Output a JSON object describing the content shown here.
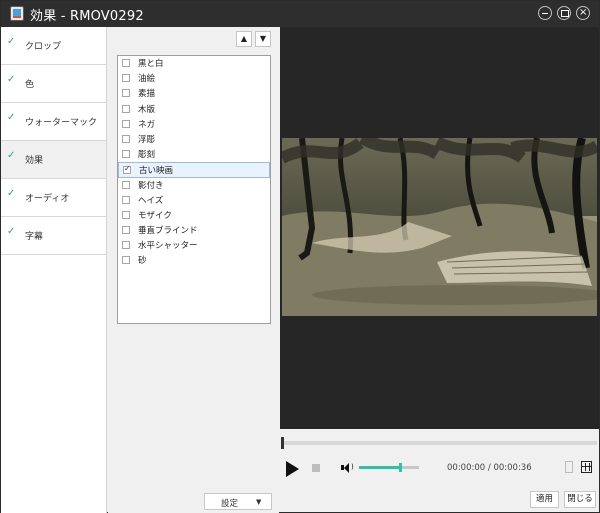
{
  "window": {
    "title": "効果 - RMOV0292"
  },
  "sidebar": {
    "items": [
      {
        "label": "クロップ",
        "checked": true,
        "active": false
      },
      {
        "label": "色",
        "checked": true,
        "active": false
      },
      {
        "label": "ウォーターマック",
        "checked": true,
        "active": false
      },
      {
        "label": "効果",
        "checked": true,
        "active": true
      },
      {
        "label": "オーディオ",
        "checked": true,
        "active": false
      },
      {
        "label": "字幕",
        "checked": true,
        "active": false
      }
    ]
  },
  "effects": {
    "items": [
      {
        "label": "黒と白",
        "checked": false,
        "selected": false
      },
      {
        "label": "油絵",
        "checked": false,
        "selected": false
      },
      {
        "label": "素描",
        "checked": false,
        "selected": false
      },
      {
        "label": "木版",
        "checked": false,
        "selected": false
      },
      {
        "label": "ネガ",
        "checked": false,
        "selected": false
      },
      {
        "label": "浮彫",
        "checked": false,
        "selected": false
      },
      {
        "label": "彫刻",
        "checked": false,
        "selected": false
      },
      {
        "label": "古い映画",
        "checked": true,
        "selected": true
      },
      {
        "label": "影付き",
        "checked": false,
        "selected": false
      },
      {
        "label": "ヘイズ",
        "checked": false,
        "selected": false
      },
      {
        "label": "モザイク",
        "checked": false,
        "selected": false
      },
      {
        "label": "垂直ブラインド",
        "checked": false,
        "selected": false
      },
      {
        "label": "水平シャッター",
        "checked": false,
        "selected": false
      },
      {
        "label": "砂",
        "checked": false,
        "selected": false
      }
    ],
    "settings_label": "設定"
  },
  "player": {
    "time": "00:00:00 / 00:00:36",
    "volume_fraction": 0.67,
    "position_fraction": 0.0
  },
  "buttons": {
    "apply": "適用",
    "close": "閉じる"
  },
  "colors": {
    "accent": "#2ec2a0",
    "check": "#24a78b",
    "selection": "#e8f3ff"
  }
}
